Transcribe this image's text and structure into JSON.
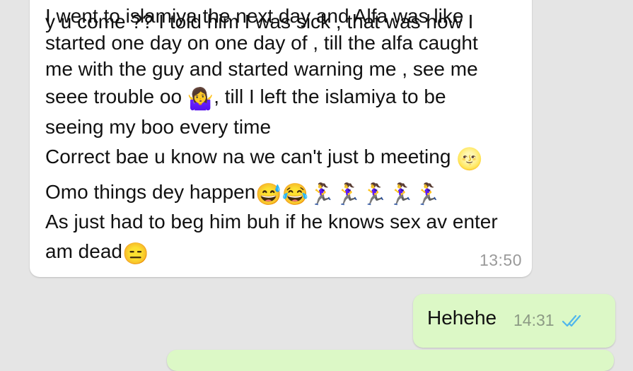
{
  "incoming_message": {
    "lines": [
      "I went to islamiya the next day and Alfa was like",
      "y u come ?? I told him I was sick , that was how I",
      "started one day on one day of , till the alfa caught",
      "me with the guy and started warning me , see me",
      "seee trouble oo",
      ", till I left the islamiya to be",
      "seeing my boo every time",
      "Correct bae u know na we can't just b meeting",
      "Omo things dey happen",
      "As just had to beg him buh if he knows sex av enter",
      "am dead"
    ],
    "emojis": {
      "shrug": "🤷‍♀️",
      "moon_face": "🌝",
      "sweat_smile": "😅",
      "joy": "😂",
      "runners": "🏃‍♀️🏃‍♀️🏃‍♀️🏃‍♀️🏃‍♀️",
      "expressionless": "😑"
    },
    "time": "13:50"
  },
  "outgoing_message": {
    "text": "Hehehe",
    "time": "14:31",
    "status_icon": "double-check-icon",
    "tick_color": "#4fb6ec"
  },
  "colors": {
    "background": "#e5e5e5",
    "incoming_bubble": "#ffffff",
    "outgoing_bubble": "#dcf8c6"
  }
}
